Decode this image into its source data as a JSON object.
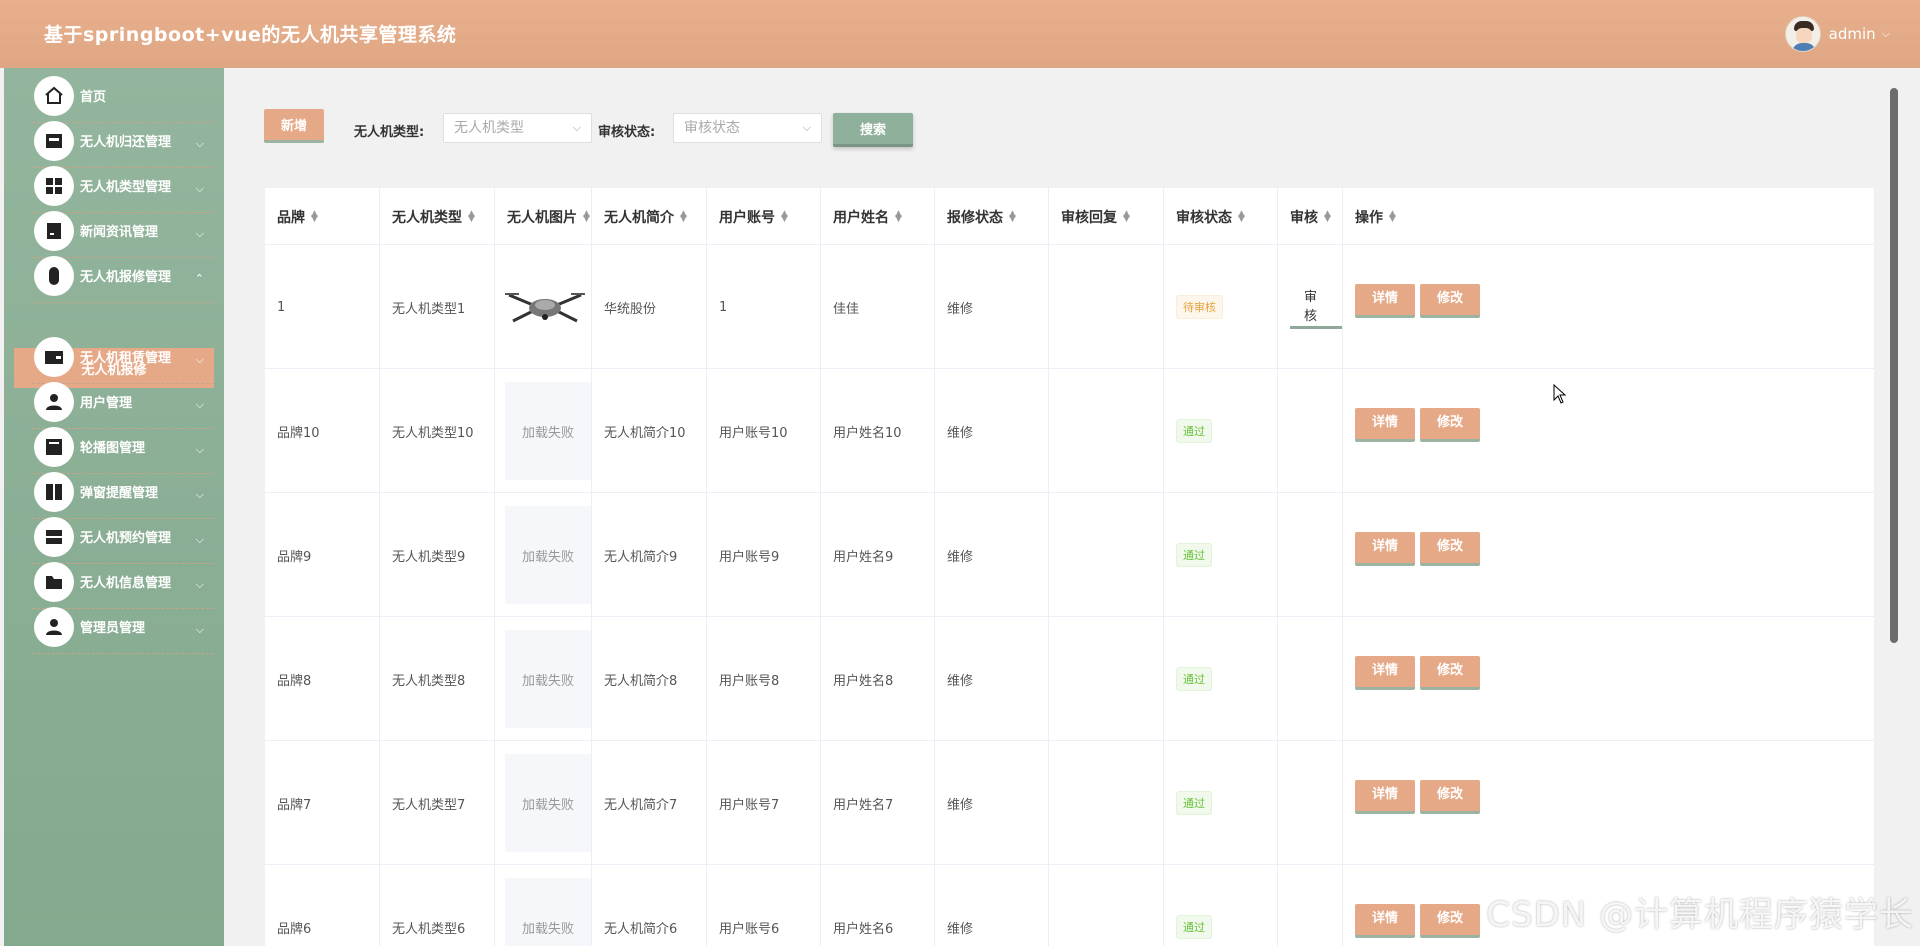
{
  "header": {
    "title": "基于springboot+vue的无人机共享管理系统",
    "username": "admin"
  },
  "sidebar": {
    "items": [
      {
        "label": "首页",
        "icon": "home-icon",
        "chevron": false
      },
      {
        "label": "无人机归还管理",
        "icon": "store-icon",
        "chevron": true
      },
      {
        "label": "无人机类型管理",
        "icon": "grid-icon",
        "chevron": true
      },
      {
        "label": "新闻资讯管理",
        "icon": "monitor-icon",
        "chevron": true
      },
      {
        "label": "无人机报修管理",
        "icon": "mouse-icon",
        "chevron": true,
        "expanded": true
      },
      {
        "label": "无人机租赁管理",
        "icon": "wallet-icon",
        "chevron": true
      },
      {
        "label": "用户管理",
        "icon": "user-icon",
        "chevron": true
      },
      {
        "label": "轮播图管理",
        "icon": "picture-icon",
        "chevron": true
      },
      {
        "label": "弹窗提醒管理",
        "icon": "book-icon",
        "chevron": true
      },
      {
        "label": "无人机预约管理",
        "icon": "tray-icon",
        "chevron": true
      },
      {
        "label": "无人机信息管理",
        "icon": "folder-icon",
        "chevron": true
      },
      {
        "label": "管理员管理",
        "icon": "user-icon",
        "chevron": true
      }
    ],
    "active_sub": "无人机报修"
  },
  "toolbar": {
    "add_label": "新增",
    "filter1_label": "无人机类型:",
    "filter1_placeholder": "无人机类型",
    "filter2_label": "审核状态:",
    "filter2_placeholder": "审核状态",
    "search_label": "搜索"
  },
  "table": {
    "columns": [
      "品牌",
      "无人机类型",
      "无人机图片",
      "无人机简介",
      "用户账号",
      "用户姓名",
      "报修状态",
      "审核回复",
      "审核状态",
      "审核",
      "操作"
    ],
    "rows": [
      {
        "brand": "1",
        "type": "无人机类型1",
        "image": "drone",
        "intro": "华统股份",
        "account": "1",
        "name": "佳佳",
        "repair": "维修",
        "reply": "",
        "status": "待审核",
        "status_kind": "pending",
        "audit": "审核"
      },
      {
        "brand": "品牌10",
        "type": "无人机类型10",
        "image": "加载失败",
        "intro": "无人机简介10",
        "account": "用户账号10",
        "name": "用户姓名10",
        "repair": "维修",
        "reply": "",
        "status": "通过",
        "status_kind": "pass",
        "audit": ""
      },
      {
        "brand": "品牌9",
        "type": "无人机类型9",
        "image": "加载失败",
        "intro": "无人机简介9",
        "account": "用户账号9",
        "name": "用户姓名9",
        "repair": "维修",
        "reply": "",
        "status": "通过",
        "status_kind": "pass",
        "audit": ""
      },
      {
        "brand": "品牌8",
        "type": "无人机类型8",
        "image": "加载失败",
        "intro": "无人机简介8",
        "account": "用户账号8",
        "name": "用户姓名8",
        "repair": "维修",
        "reply": "",
        "status": "通过",
        "status_kind": "pass",
        "audit": ""
      },
      {
        "brand": "品牌7",
        "type": "无人机类型7",
        "image": "加载失败",
        "intro": "无人机简介7",
        "account": "用户账号7",
        "name": "用户姓名7",
        "repair": "维修",
        "reply": "",
        "status": "通过",
        "status_kind": "pass",
        "audit": ""
      },
      {
        "brand": "品牌6",
        "type": "无人机类型6",
        "image": "加载失败",
        "intro": "无人机简介6",
        "account": "用户账号6",
        "name": "用户姓名6",
        "repair": "维修",
        "reply": "",
        "status": "通过",
        "status_kind": "pass",
        "audit": ""
      }
    ],
    "detail_label": "详情",
    "edit_label": "修改"
  },
  "watermark": "CSDN @计算机程序猿学长",
  "colors": {
    "header": "#e0a784",
    "sidebar": "#8daf97",
    "button": "#e6a988",
    "search": "#8fb09a"
  }
}
